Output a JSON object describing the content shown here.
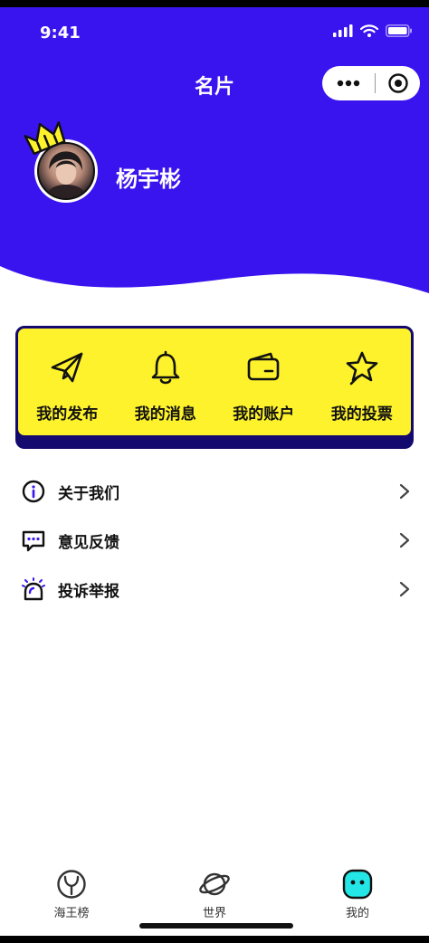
{
  "status": {
    "time": "9:41"
  },
  "nav": {
    "title": "名片"
  },
  "colors": {
    "brand": "#3a14ef",
    "card_yellow": "#fdf22b",
    "card_border": "#14096e",
    "tab_active": "#24e6e6"
  },
  "profile": {
    "name": "杨宇彬"
  },
  "quick_actions": [
    {
      "icon": "paper-plane-icon",
      "label": "我的发布"
    },
    {
      "icon": "bell-icon",
      "label": "我的消息"
    },
    {
      "icon": "wallet-icon",
      "label": "我的账户"
    },
    {
      "icon": "star-icon",
      "label": "我的投票"
    }
  ],
  "menu": [
    {
      "icon": "info-icon",
      "label": "关于我们"
    },
    {
      "icon": "feedback-icon",
      "label": "意见反馈"
    },
    {
      "icon": "alarm-icon",
      "label": "投诉举报"
    }
  ],
  "tabs": [
    {
      "icon": "ranking-icon",
      "label": "海王榜",
      "active": false
    },
    {
      "icon": "planet-icon",
      "label": "世界",
      "active": false
    },
    {
      "icon": "profile-face-icon",
      "label": "我的",
      "active": true
    }
  ]
}
